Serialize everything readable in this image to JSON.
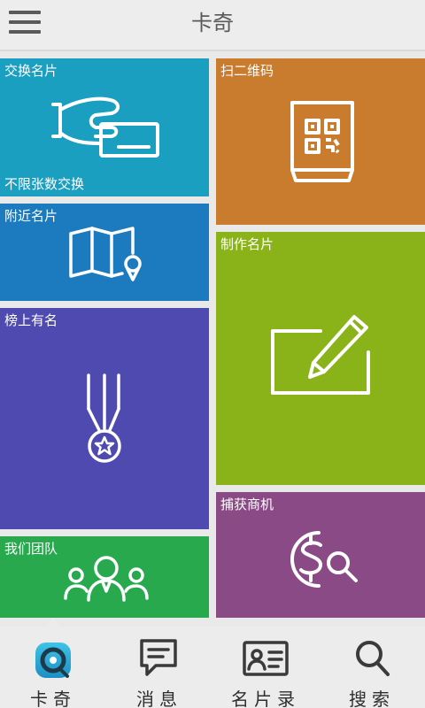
{
  "header": {
    "title": "卡奇",
    "menu_icon": "hamburger-menu-icon"
  },
  "tiles": {
    "exchange": {
      "label": "交换名片",
      "sublabel": "不限张数交换",
      "color": "#1a9fc0",
      "icon": "hand-card-icon"
    },
    "scan": {
      "label": "扫二维码",
      "color": "#ca7c2e",
      "icon": "qr-scan-icon"
    },
    "nearby": {
      "label": "附近名片",
      "color": "#1c7bbf",
      "icon": "map-pin-icon"
    },
    "make": {
      "label": "制作名片",
      "color": "#8ab319",
      "icon": "edit-pen-icon"
    },
    "ranking": {
      "label": "榜上有名",
      "color": "#4f4ab0",
      "icon": "medal-icon"
    },
    "opportunity": {
      "label": "捕获商机",
      "color": "#8a4a86",
      "icon": "dollar-search-icon"
    },
    "team": {
      "label": "我们团队",
      "color": "#28a94e",
      "icon": "team-people-icon"
    }
  },
  "nav": {
    "items": [
      {
        "label": "卡奇",
        "icon": "kaqi-logo-icon",
        "active": true
      },
      {
        "label": "消息",
        "icon": "message-icon",
        "active": false
      },
      {
        "label": "名片录",
        "icon": "contact-card-icon",
        "active": false
      },
      {
        "label": "搜索",
        "icon": "search-icon",
        "active": false
      }
    ]
  }
}
